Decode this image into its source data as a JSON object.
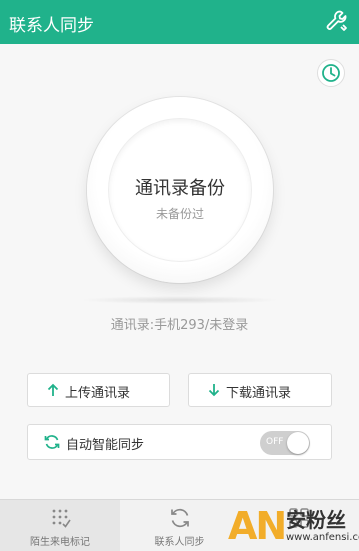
{
  "header": {
    "title": "联系人同步",
    "settings_icon": "wrench-icon"
  },
  "history_icon": "clock-icon",
  "backup": {
    "title": "通讯录备份",
    "subtitle": "未备份过"
  },
  "status": "通讯录:手机293/未登录",
  "actions": {
    "upload_label": "上传通讯录",
    "download_label": "下载通讯录"
  },
  "auto_sync": {
    "label": "自动智能同步",
    "toggle_text": "OFF",
    "enabled": false
  },
  "tabs": [
    {
      "label": "陌生来电标记",
      "icon": "mark-icon",
      "active": true
    },
    {
      "label": "联系人同步",
      "icon": "sync-icon",
      "active": false
    },
    {
      "label": "",
      "icon": "grid-icon",
      "active": false
    }
  ],
  "watermark": {
    "brand": "AN",
    "name": "安粉丝",
    "url": "www.anfensi.com"
  },
  "colors": {
    "accent": "#20b28b",
    "watermark": "#f2ad2a"
  }
}
